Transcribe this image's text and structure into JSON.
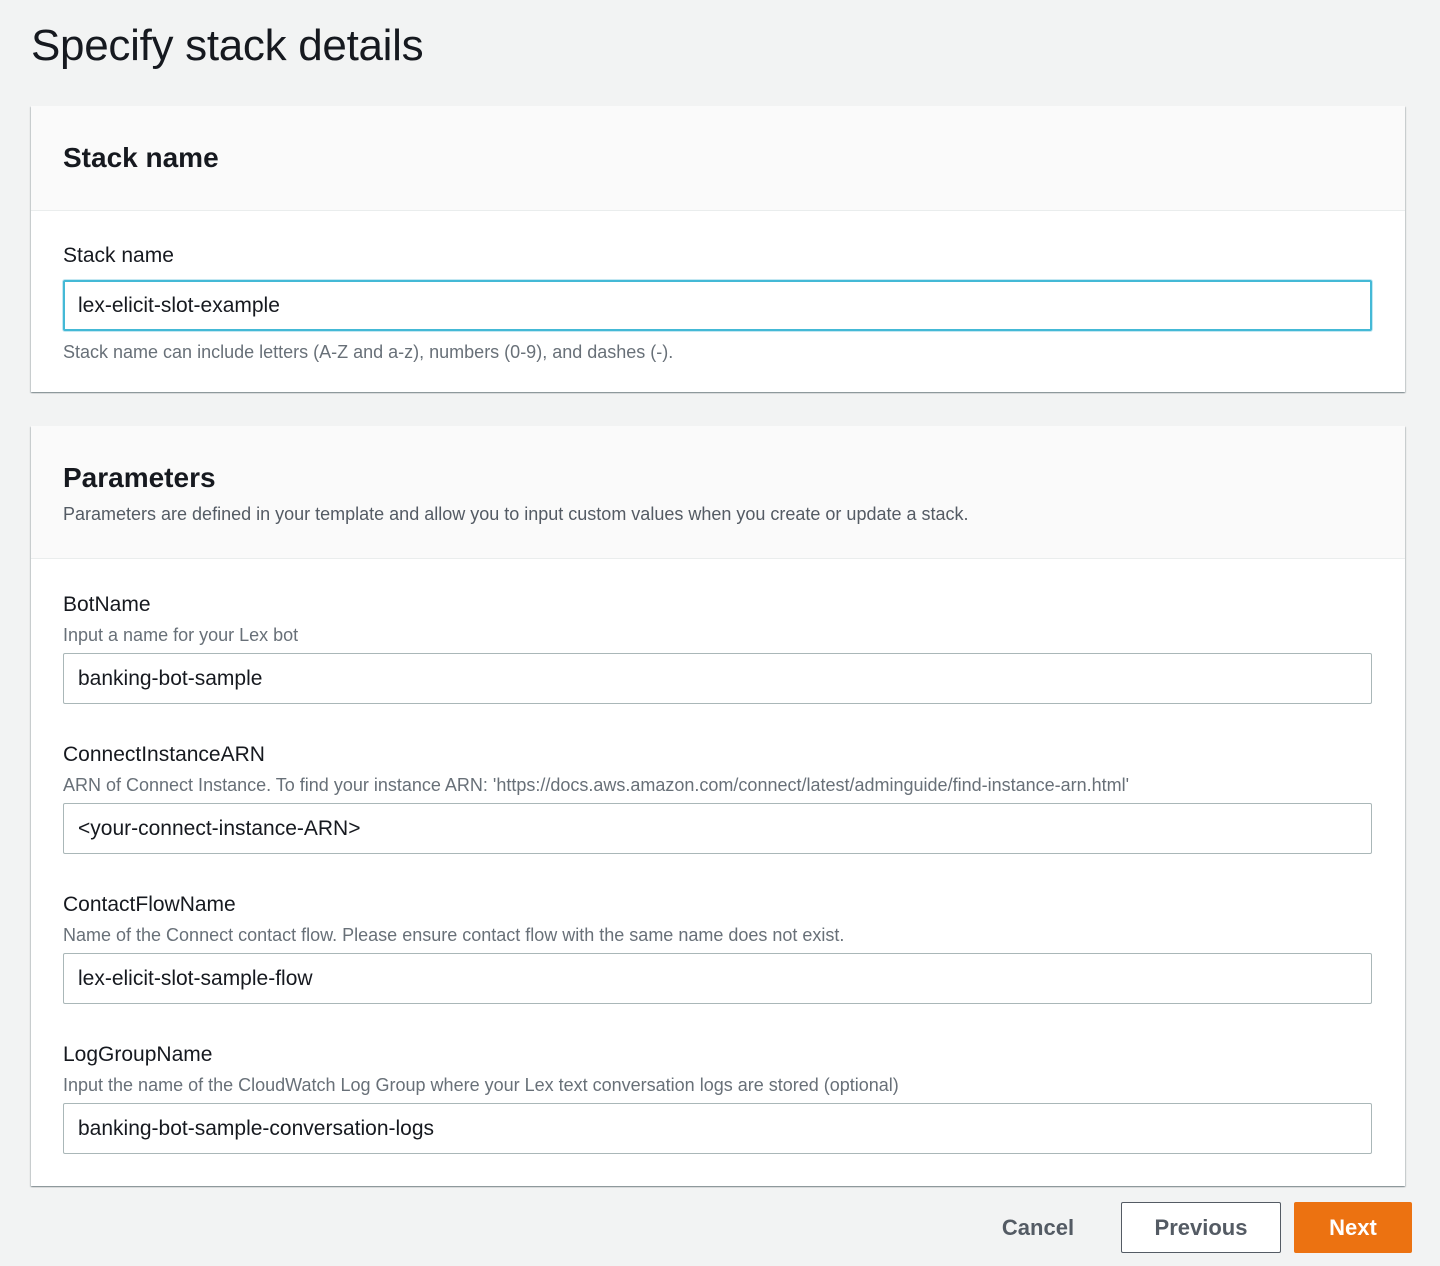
{
  "page": {
    "title": "Specify stack details"
  },
  "stack_panel": {
    "title": "Stack name",
    "field_label": "Stack name",
    "value": "lex-elicit-slot-example",
    "hint": "Stack name can include letters (A-Z and a-z), numbers (0-9), and dashes (-)."
  },
  "params_panel": {
    "title": "Parameters",
    "description": "Parameters are defined in your template and allow you to input custom values when you create or update a stack.",
    "fields": [
      {
        "label": "BotName",
        "description": "Input a name for your Lex bot",
        "value": "banking-bot-sample"
      },
      {
        "label": "ConnectInstanceARN",
        "description": "ARN of Connect Instance. To find your instance ARN: 'https://docs.aws.amazon.com/connect/latest/adminguide/find-instance-arn.html'",
        "value": "<your-connect-instance-ARN>"
      },
      {
        "label": "ContactFlowName",
        "description": "Name of the Connect contact flow. Please ensure contact flow with the same name does not exist.",
        "value": "lex-elicit-slot-sample-flow"
      },
      {
        "label": "LogGroupName",
        "description": "Input the name of the CloudWatch Log Group where your Lex text conversation logs are stored (optional)",
        "value": "banking-bot-sample-conversation-logs"
      }
    ]
  },
  "footer": {
    "cancel_label": "Cancel",
    "previous_label": "Previous",
    "next_label": "Next"
  },
  "colors": {
    "primary_button": "#ec7211",
    "focus_border": "#44b9d6",
    "background": "#f2f3f3"
  }
}
